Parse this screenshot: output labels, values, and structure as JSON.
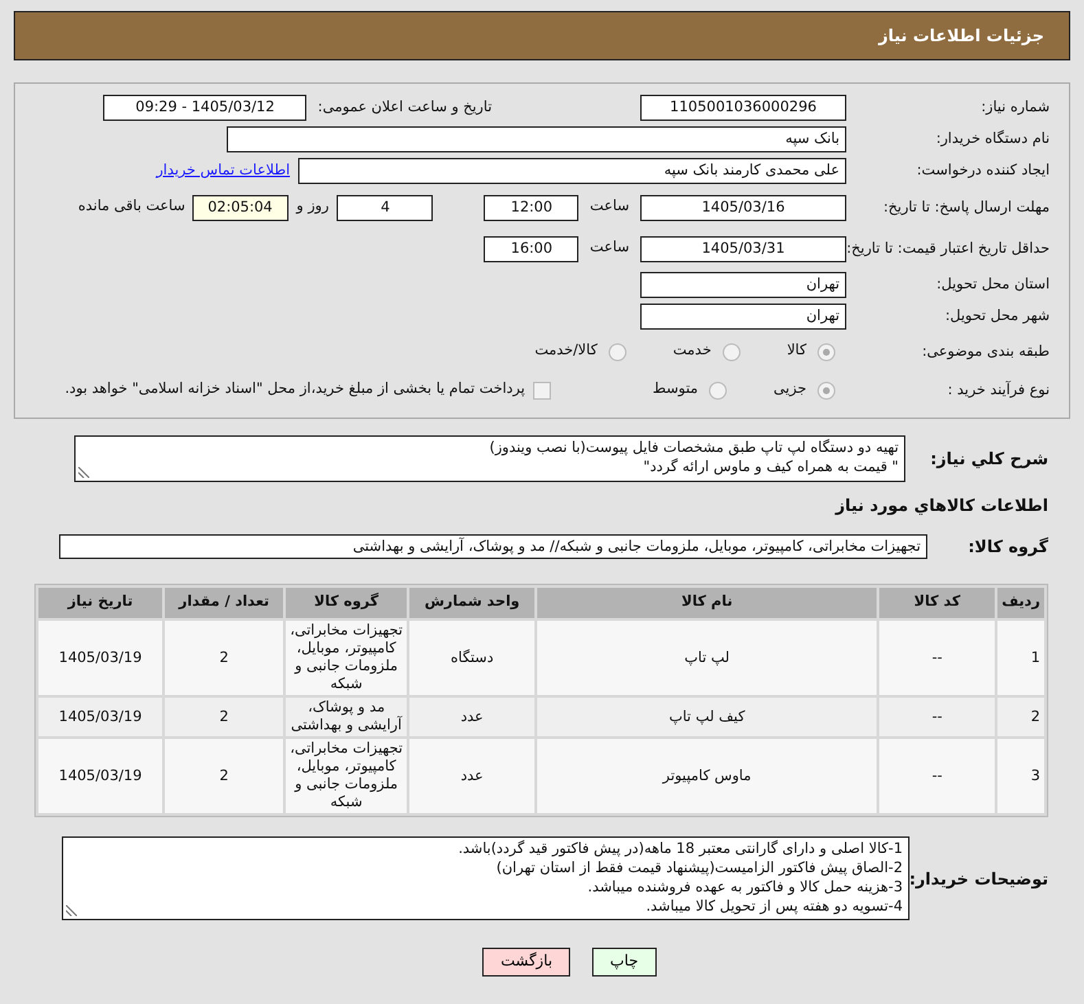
{
  "header": {
    "title": "جزئیات اطلاعات نیاز"
  },
  "form": {
    "need_number": {
      "label": "شماره نیاز:",
      "value": "1105001036000296"
    },
    "announce": {
      "label": "تاریخ و ساعت اعلان عمومی:",
      "value": "1405/03/12 - 09:29"
    },
    "buyer_org": {
      "label": "نام دستگاه خریدار:",
      "value": "بانک سپه"
    },
    "requester": {
      "label": "ایجاد کننده درخواست:",
      "value": "علی محمدی کارمند بانک سپه"
    },
    "contact_link": "اطلاعات تماس خریدار",
    "response_deadline": {
      "label": "مهلت ارسال پاسخ: تا تاریخ:",
      "date": "1405/03/16",
      "time_label": "ساعت",
      "time": "12:00",
      "days": "4",
      "days_label": "روز و",
      "remaining": "02:05:04",
      "remaining_label": "ساعت باقی مانده"
    },
    "price_validity": {
      "label": "حداقل تاریخ اعتبار قیمت: تا تاریخ:",
      "date": "1405/03/31",
      "time_label": "ساعت",
      "time": "16:00"
    },
    "province": {
      "label": "استان محل تحویل:",
      "value": "تهران"
    },
    "city": {
      "label": "شهر محل تحویل:",
      "value": "تهران"
    },
    "category": {
      "label": "طبقه بندی موضوعی:",
      "options": [
        {
          "label": "کالا",
          "selected": true
        },
        {
          "label": "خدمت",
          "selected": false
        },
        {
          "label": "کالا/خدمت",
          "selected": false
        }
      ]
    },
    "process": {
      "label": "نوع فرآیند خرید :",
      "options": [
        {
          "label": "جزیی",
          "selected": true
        },
        {
          "label": "متوسط",
          "selected": false
        }
      ],
      "payment": {
        "label": "پرداخت تمام یا بخشی از مبلغ خرید،از محل \"اسناد خزانه اسلامی\" خواهد بود.",
        "checked": false
      }
    }
  },
  "description": {
    "label": "شرح کلي نياز:",
    "lines": [
      "تهیه دو دستگاه لپ تاپ طبق مشخصات فایل پیوست(با نصب ویندوز)",
      "\" قیمت به همراه کیف و ماوس ارائه گردد\""
    ]
  },
  "goods_heading": "اطلاعات کالاهاي مورد نياز",
  "goods_group": {
    "label": "گروه کالا:",
    "value": "تجهیزات مخابراتی، کامپیوتر، موبایل، ملزومات جانبی و شبکه// مد و پوشاک، آرایشی و بهداشتی"
  },
  "table": {
    "columns": [
      "ردیف",
      "کد کالا",
      "نام کالا",
      "واحد شمارش",
      "گروه کالا",
      "تعداد / مقدار",
      "تاریخ نیاز"
    ],
    "rows": [
      [
        "1",
        "--",
        "لپ تاپ",
        "دستگاه",
        "تجهیزات مخابراتی، کامپیوتر، موبایل، ملزومات جانبی و شبکه",
        "2",
        "1405/03/19"
      ],
      [
        "2",
        "--",
        "کیف لپ تاپ",
        "عدد",
        "مد و پوشاک، آرایشی و بهداشتی",
        "2",
        "1405/03/19"
      ],
      [
        "3",
        "--",
        "ماوس کامپیوتر",
        "عدد",
        "تجهیزات مخابراتی، کامپیوتر، موبایل، ملزومات جانبی و شبکه",
        "2",
        "1405/03/19"
      ]
    ]
  },
  "buyer_notes": {
    "label": "توضیحات خریدار:",
    "lines": [
      "1-کالا اصلی و دارای گارانتی معتبر 18 ماهه(در پیش فاکتور قید گردد)باشد.",
      "2-الصاق پیش فاکتور الزامیست(پیشنهاد قیمت فقط از استان تهران)",
      "3-هزینه حمل کالا و فاکتور به عهده فروشنده میباشد.",
      "4-تسویه دو هفته پس از تحویل کالا میباشد."
    ]
  },
  "buttons": [
    {
      "label": "چاپ",
      "kind": "print"
    },
    {
      "label": "بازگشت",
      "kind": "back"
    }
  ]
}
